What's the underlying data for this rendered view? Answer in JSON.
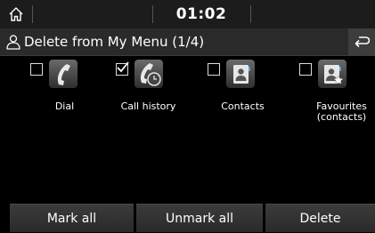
{
  "status": {
    "time": "01:02"
  },
  "header": {
    "title": "Delete from My Menu (1/4)"
  },
  "items": [
    {
      "label": "Dial",
      "checked": false,
      "icon": "phone-icon"
    },
    {
      "label": "Call history",
      "checked": true,
      "icon": "call-history-icon"
    },
    {
      "label": "Contacts",
      "checked": false,
      "icon": "contacts-icon"
    },
    {
      "label": "Favourites (contacts)",
      "label_line1": "Favourites",
      "label_line2": "(contacts)",
      "checked": false,
      "icon": "favourite-contacts-icon"
    }
  ],
  "footer": {
    "mark_all": "Mark all",
    "unmark_all": "Unmark all",
    "delete": "Delete"
  }
}
